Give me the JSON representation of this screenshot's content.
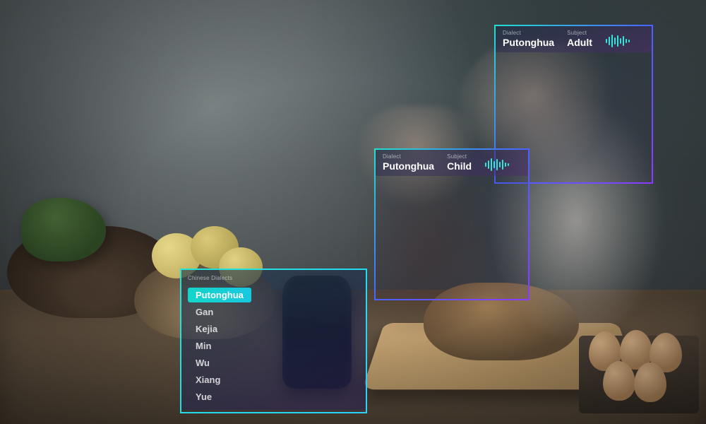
{
  "overlays": {
    "adult": {
      "dialect_label": "Dialect",
      "dialect_value": "Putonghua",
      "subject_label": "Subject",
      "subject_value": "Adult"
    },
    "child": {
      "dialect_label": "Dialect",
      "dialect_value": "Putonghua",
      "subject_label": "Subject",
      "subject_value": "Child"
    },
    "device": {
      "list_label": "Chinese Dialects",
      "items": [
        "Putonghua",
        "Gan",
        "Kejia",
        "Min",
        "Wu",
        "Xiang",
        "Yue"
      ],
      "selected_index": 0
    }
  },
  "colors": {
    "gradient_start": "#22e0d0",
    "gradient_mid": "#4a63ff",
    "gradient_end": "#8b3bff",
    "highlight": "#13d6c8"
  }
}
